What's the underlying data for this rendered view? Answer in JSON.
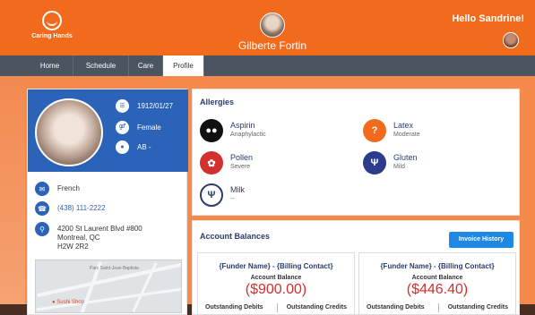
{
  "header": {
    "logo_text": "Caring Hands",
    "client_name": "Gilberte Fortin",
    "greeting": "Hello Sandrine!"
  },
  "nav": {
    "tabs": [
      {
        "label": "Home",
        "active": false
      },
      {
        "label": "Schedule",
        "active": false
      },
      {
        "label": "Care",
        "active": false
      },
      {
        "label": "Profile",
        "active": true
      }
    ]
  },
  "profile": {
    "dob": "1912/01/27",
    "gender": "Female",
    "blood_type": "AB -",
    "language": "French",
    "phone": "(438) 111-2222",
    "address": [
      "4200 St Laurent Blvd #800",
      "Montreal, QC",
      "H2W 2R2"
    ],
    "map_labels": [
      "Parc Saint-Jean Baptiste",
      "Sushi Shop"
    ]
  },
  "allergies": {
    "title": "Allergies",
    "items": [
      {
        "name": "Aspirin",
        "severity": "Anaphylactic",
        "icon": "pills-icon",
        "color": "#111111"
      },
      {
        "name": "Latex",
        "severity": "Moderate",
        "icon": "question-icon",
        "color": "#f26b1d"
      },
      {
        "name": "Pollen",
        "severity": "Severe",
        "icon": "leaf-icon",
        "color": "#d32f2f"
      },
      {
        "name": "Gluten",
        "severity": "Mild",
        "icon": "utensils-icon",
        "color": "#2a3c8b"
      },
      {
        "name": "Milk",
        "severity": "--",
        "icon": "utensils-icon",
        "color": "#ffffff"
      }
    ]
  },
  "balances": {
    "title": "Account Balances",
    "invoice_button": "Invoice History",
    "cards": [
      {
        "funder": "{Funder Name} - {Billing Contact}",
        "label": "Account Balance",
        "amount": "($900.00)",
        "debits": "Outstanding Debits",
        "credits": "Outstanding Credits"
      },
      {
        "funder": "{Funder Name} - {Billing Contact}",
        "label": "Account Balance",
        "amount": "($446.40)",
        "debits": "Outstanding Debits",
        "credits": "Outstanding Credits"
      }
    ]
  },
  "colors": {
    "brand_orange": "#f26b1d",
    "nav_dark": "#4a5561",
    "profile_blue": "#2b63b8",
    "amount_red": "#d32f2f"
  }
}
